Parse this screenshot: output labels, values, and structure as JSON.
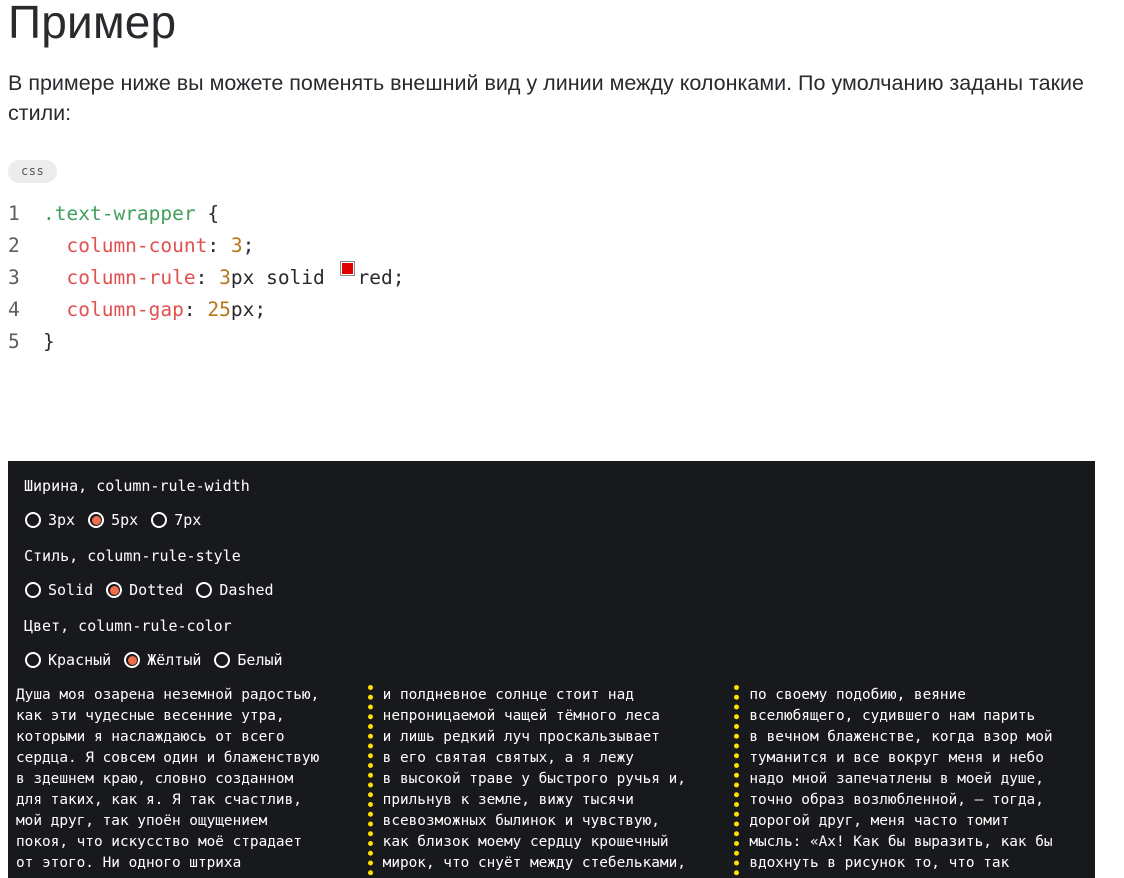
{
  "heading": "Пример",
  "intro": "В примере ниже вы можете поменять внешний вид у линии между колонками. По умолчанию заданы такие стили:",
  "code_lang": "css",
  "code": {
    "line1": {
      "num": "1",
      "selector": ".text-wrapper",
      "rest": " {"
    },
    "line2": {
      "num": "2",
      "indent": "  ",
      "prop": "column-count",
      "sep": ": ",
      "num_value": "3",
      "end": ";"
    },
    "line3": {
      "num": "3",
      "indent": "  ",
      "prop": "column-rule",
      "sep": ": ",
      "num_value": "3",
      "unit_rest": "px solid ",
      "color_word": "red",
      "end": ";",
      "swatch_color": "#e00000"
    },
    "line4": {
      "num": "4",
      "indent": "  ",
      "prop": "column-gap",
      "sep": ": ",
      "num_value": "25",
      "unit_rest": "px",
      "end": ";"
    },
    "line5": {
      "num": "5",
      "close": "}"
    }
  },
  "demo": {
    "width_group": {
      "legend": "Ширина, column-rule-width",
      "options": [
        "3px",
        "5px",
        "7px"
      ],
      "selected": "5px"
    },
    "style_group": {
      "legend": "Стиль, column-rule-style",
      "options": [
        "Solid",
        "Dotted",
        "Dashed"
      ],
      "selected": "Dotted"
    },
    "color_group": {
      "legend": "Цвет, column-rule-color",
      "options": [
        "Красный",
        "Жёлтый",
        "Белый"
      ],
      "selected": "Жёлтый"
    },
    "rule_color": "#ffe000",
    "accent_color": "#f06d4b",
    "columns": [
      [
        "Душа моя озарена неземной радостью,",
        "как эти чудесные весенние утра,",
        "которыми я наслаждаюсь от всего",
        "сердца. Я совсем один и блаженствую",
        "в здешнем краю, словно созданном",
        "для таких, как я. Я так счастлив,",
        "мой друг, так упоён ощущением",
        "покоя, что искусство моё страдает",
        "от этого. Ни одного штриха"
      ],
      [
        "и полдневное солнце стоит над",
        "непроницаемой чащей тёмного леса",
        "и лишь редкий луч проскальзывает",
        "в его святая святых, а я лежу",
        "в высокой траве у быстрого ручья и,",
        "прильнув к земле, вижу тысячи",
        "всевозможных былинок и чувствую,",
        "как близок моему сердцу крошечный",
        "мирок, что снуёт между стебельками,"
      ],
      [
        "по своему подобию, веяние",
        "вселюбящего, судившего нам парить",
        "в вечном блаженстве, когда взор мой",
        "туманится и все вокруг меня и небо",
        "надо мной запечатлены в моей душе,",
        "точно образ возлюбленной, — тогда,",
        "дорогой друг, меня часто томит",
        "мысль: «Ах! Как бы выразить, как бы",
        "вдохнуть в рисунок то, что так"
      ]
    ]
  }
}
